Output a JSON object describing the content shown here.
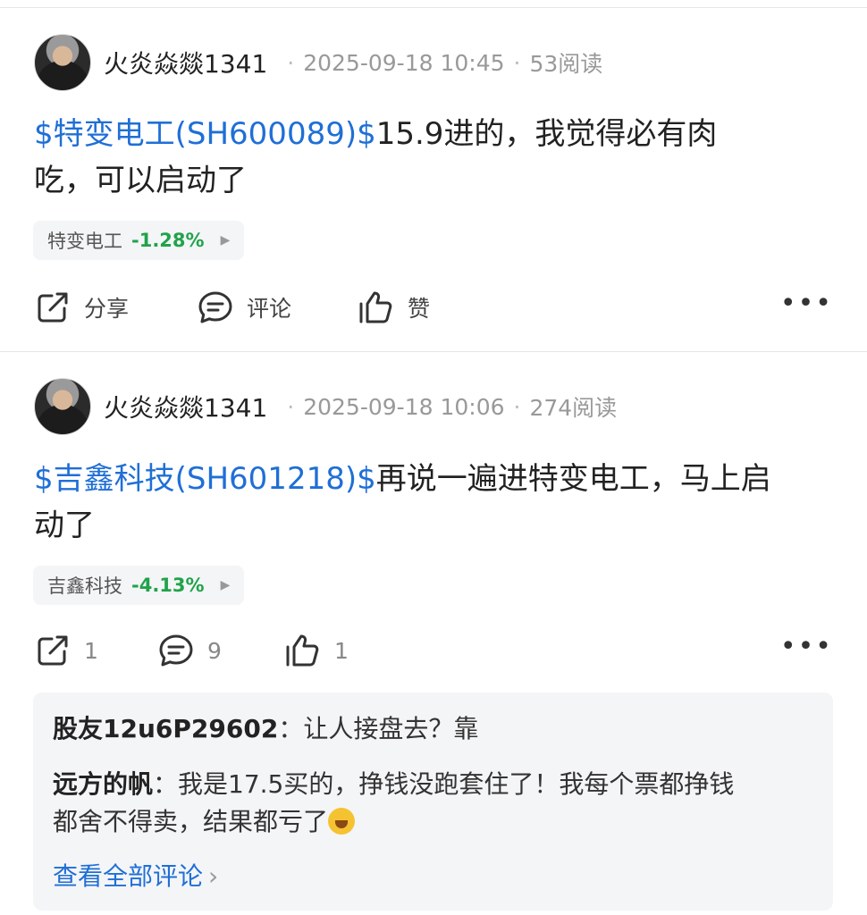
{
  "posts": [
    {
      "username": "火炎焱燚1341",
      "timestamp": "2025-09-18 10:45",
      "reads": "53阅读",
      "tag": "$特变电工(SH600089)$",
      "text_line1": "15.9进的，我觉得必有肉",
      "text_line2": "吃，可以启动了",
      "stock_name": "特变电工",
      "stock_change": "-1.28%",
      "actions": {
        "share": "分享",
        "comment": "评论",
        "like": "赞"
      }
    },
    {
      "username": "火炎焱燚1341",
      "timestamp": "2025-09-18 10:06",
      "reads": "274阅读",
      "tag": "$吉鑫科技(SH601218)$",
      "text_line1": "再说一遍进特变电工，马上启",
      "text_line2": "动了",
      "stock_name": "吉鑫科技",
      "stock_change": "-4.13%",
      "actions": {
        "share": "1",
        "comment": "9",
        "like": "1"
      }
    }
  ],
  "comments": [
    {
      "author": "股友12u6P29602",
      "separator": "：",
      "text": "让人接盘去？靠"
    },
    {
      "author": "远方的帆",
      "separator": "：",
      "text_line1": "我是17.5买的，挣钱没跑套住了！我每个票都挣钱",
      "text_line2": "都舍不得卖，结果都亏了",
      "emoji": "crying-laughing-emoji"
    }
  ],
  "view_all_comments": "查看全部评论",
  "more_icon": "more-icon",
  "colors": {
    "link": "#1f6fd6",
    "stock_down": "#21a34a"
  }
}
